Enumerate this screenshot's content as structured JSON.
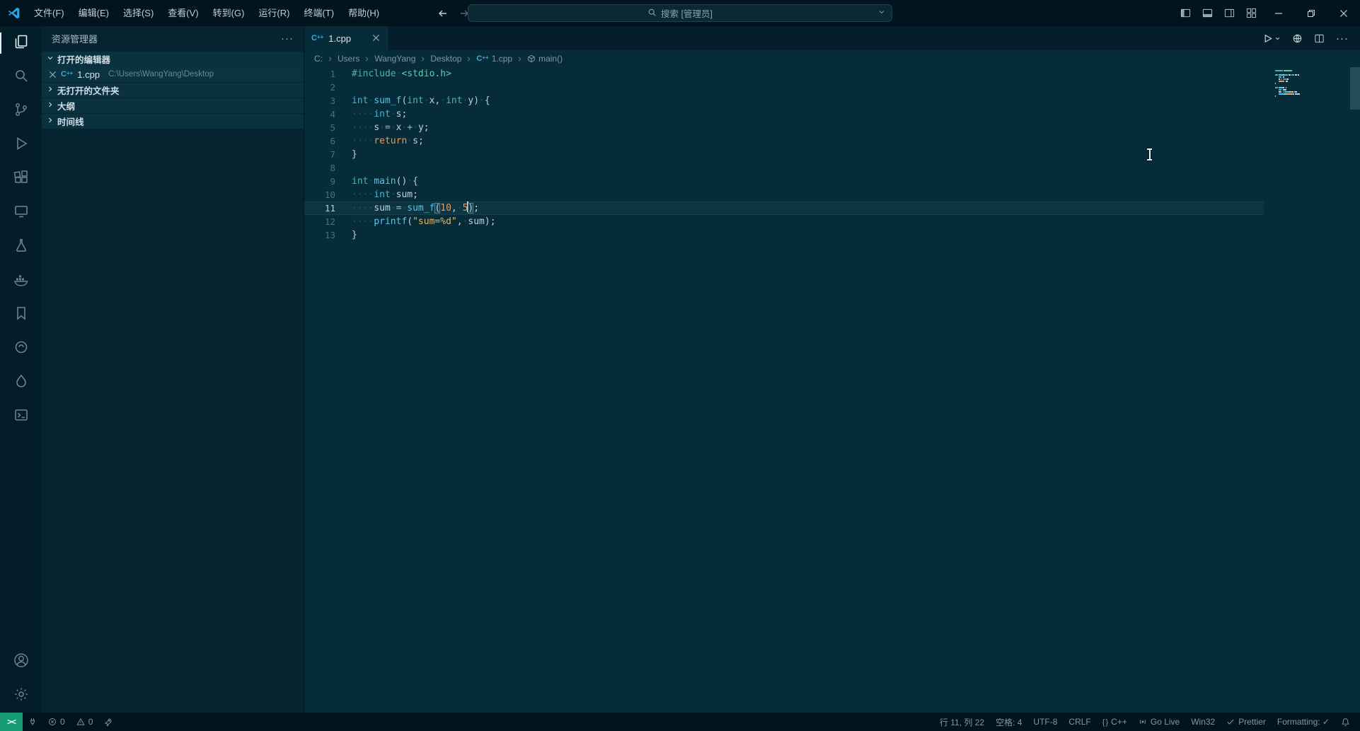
{
  "titlebar": {
    "menus": [
      "文件(F)",
      "编辑(E)",
      "选择(S)",
      "查看(V)",
      "转到(G)",
      "运行(R)",
      "终端(T)",
      "帮助(H)"
    ],
    "search_text": "搜索 [管理员]"
  },
  "activity_bar": {
    "items": [
      {
        "name": "explorer",
        "active": true
      },
      {
        "name": "search",
        "active": false
      },
      {
        "name": "source-control",
        "active": false
      },
      {
        "name": "run-debug",
        "active": false
      },
      {
        "name": "extensions",
        "active": false
      },
      {
        "name": "remote-explorer",
        "active": false
      },
      {
        "name": "testing",
        "active": false
      },
      {
        "name": "docker",
        "active": false
      },
      {
        "name": "bookmarks",
        "active": false
      },
      {
        "name": "live-share",
        "active": false
      },
      {
        "name": "code-runner",
        "active": false
      },
      {
        "name": "terminal",
        "active": false
      }
    ],
    "bottom": [
      {
        "name": "account",
        "active": false
      },
      {
        "name": "settings",
        "active": false
      }
    ]
  },
  "sidebar": {
    "title": "资源管理器",
    "sections": [
      {
        "label": "打开的编辑器",
        "expanded": true
      },
      {
        "label": "无打开的文件夹",
        "expanded": false
      },
      {
        "label": "大纲",
        "expanded": false
      },
      {
        "label": "时间线",
        "expanded": false
      }
    ],
    "open_editor": {
      "file": "1.cpp",
      "path": "C:\\Users\\WangYang\\Desktop"
    }
  },
  "editor": {
    "tab_label": "1.cpp",
    "breadcrumbs": [
      {
        "label": "C:"
      },
      {
        "label": "Users"
      },
      {
        "label": "WangYang"
      },
      {
        "label": "Desktop"
      },
      {
        "label": "1.cpp",
        "icon": "cpp"
      },
      {
        "label": "main()",
        "icon": "method"
      }
    ],
    "current_line": 11,
    "lines": [
      {
        "n": 1,
        "t": [
          [
            "#include",
            "dir"
          ],
          [
            "·",
            "ws"
          ],
          [
            "<stdio.h>",
            "inc"
          ]
        ]
      },
      {
        "n": 2,
        "t": []
      },
      {
        "n": 3,
        "t": [
          [
            "int",
            "kw"
          ],
          [
            "·",
            "ws"
          ],
          [
            "sum_f",
            "fn"
          ],
          [
            "(",
            "punct"
          ],
          [
            "int",
            "kw"
          ],
          [
            "·",
            "ws"
          ],
          [
            "x",
            "var"
          ],
          [
            ",",
            "punct"
          ],
          [
            "·",
            "ws"
          ],
          [
            "int",
            "kw"
          ],
          [
            "·",
            "ws"
          ],
          [
            "y",
            "var"
          ],
          [
            ")",
            "punct"
          ],
          [
            "·",
            "ws"
          ],
          [
            "{",
            "punct"
          ]
        ]
      },
      {
        "n": 4,
        "t": [
          [
            "····",
            "ws"
          ],
          [
            "int",
            "kw"
          ],
          [
            "·",
            "ws"
          ],
          [
            "s",
            "var"
          ],
          [
            ";",
            "punct"
          ]
        ]
      },
      {
        "n": 5,
        "t": [
          [
            "····",
            "ws"
          ],
          [
            "s",
            "var"
          ],
          [
            "·",
            "ws"
          ],
          [
            "=",
            "op"
          ],
          [
            "·",
            "ws"
          ],
          [
            "x",
            "var"
          ],
          [
            "·",
            "ws"
          ],
          [
            "+",
            "op"
          ],
          [
            "·",
            "ws"
          ],
          [
            "y",
            "var"
          ],
          [
            ";",
            "punct"
          ]
        ]
      },
      {
        "n": 6,
        "t": [
          [
            "····",
            "ws"
          ],
          [
            "return",
            "ret"
          ],
          [
            "·",
            "ws"
          ],
          [
            "s",
            "var"
          ],
          [
            ";",
            "punct"
          ]
        ]
      },
      {
        "n": 7,
        "t": [
          [
            "}",
            "punct"
          ]
        ]
      },
      {
        "n": 8,
        "t": []
      },
      {
        "n": 9,
        "t": [
          [
            "int",
            "kw"
          ],
          [
            "·",
            "ws"
          ],
          [
            "main",
            "fn"
          ],
          [
            "()",
            "punct"
          ],
          [
            "·",
            "ws"
          ],
          [
            "{",
            "punct"
          ]
        ]
      },
      {
        "n": 10,
        "t": [
          [
            "····",
            "ws"
          ],
          [
            "int",
            "kw"
          ],
          [
            "·",
            "ws"
          ],
          [
            "sum",
            "var"
          ],
          [
            ";",
            "punct"
          ]
        ]
      },
      {
        "n": 11,
        "t": [
          [
            "····",
            "ws"
          ],
          [
            "sum",
            "var"
          ],
          [
            "·",
            "ws"
          ],
          [
            "=",
            "op"
          ],
          [
            "·",
            "ws"
          ],
          [
            "sum_f",
            "fn"
          ],
          [
            "(",
            "punct match"
          ],
          [
            "10",
            "num"
          ],
          [
            ",",
            "punct"
          ],
          [
            "·",
            "ws"
          ],
          [
            "5",
            "num"
          ],
          [
            "",
            "caret"
          ],
          [
            ")",
            "punct match"
          ],
          [
            ";",
            "punct"
          ]
        ]
      },
      {
        "n": 12,
        "t": [
          [
            "····",
            "ws"
          ],
          [
            "printf",
            "fn"
          ],
          [
            "(",
            "punct"
          ],
          [
            "\"sum=%d\"",
            "str"
          ],
          [
            ",",
            "punct"
          ],
          [
            "·",
            "ws"
          ],
          [
            "sum",
            "var"
          ],
          [
            ")",
            "punct"
          ],
          [
            ";",
            "punct"
          ]
        ]
      },
      {
        "n": 13,
        "t": [
          [
            "}",
            "punct"
          ]
        ]
      }
    ]
  },
  "status_bar": {
    "remote": "><",
    "left": [
      {
        "name": "plug",
        "icon": "plug",
        "label": ""
      },
      {
        "name": "errors",
        "icon": "error",
        "label": "0"
      },
      {
        "name": "warnings",
        "icon": "warning",
        "label": "0"
      },
      {
        "name": "live-reload",
        "icon": "rocket",
        "label": ""
      }
    ],
    "right": [
      {
        "name": "cursor-position",
        "label": "行 11, 列 22"
      },
      {
        "name": "indentation",
        "label": "空格: 4"
      },
      {
        "name": "encoding",
        "label": "UTF-8"
      },
      {
        "name": "eol",
        "label": "CRLF"
      },
      {
        "name": "language-mode",
        "icon": "braces",
        "label": "C++"
      },
      {
        "name": "go-live",
        "icon": "broadcast",
        "label": "Go Live"
      },
      {
        "name": "platform",
        "label": "Win32"
      },
      {
        "name": "prettier",
        "icon": "check",
        "label": "Prettier"
      },
      {
        "name": "formatting-toggle",
        "label": "Formatting: ✓"
      },
      {
        "name": "notifications-bell",
        "icon": "bell",
        "label": ""
      }
    ]
  },
  "colors": {
    "keyword": "#45b3c9",
    "function": "#58c6e7",
    "number": "#e3a05c",
    "string": "#e5b567",
    "directive": "#4db6a2",
    "include_path": "#62c7b2",
    "return_kw": "#e89a5b",
    "variable": "#bfd3da",
    "operator": "#9db6bf",
    "punctuation": "#bccfd6",
    "whitespace_dot": "#265666",
    "remote_green": "#149b72",
    "cpp_icon_blue": "#3fa9dc"
  }
}
